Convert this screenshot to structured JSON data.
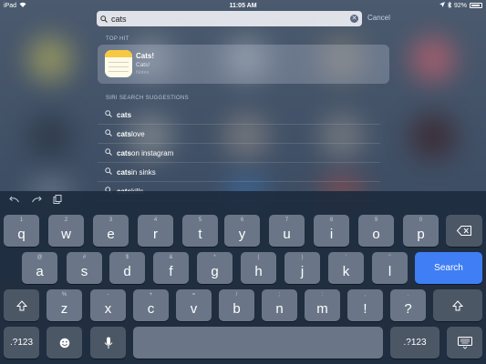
{
  "status_bar": {
    "device": "iPad",
    "time": "11:05 AM",
    "battery": "92%",
    "battery_level": 0.92
  },
  "search": {
    "query": "cats",
    "cancel_label": "Cancel"
  },
  "top_hit": {
    "section_label": "TOP HIT",
    "title": "Cats!",
    "subtitle": "Cats!",
    "app": "Notes"
  },
  "siri_suggestions": {
    "section_label": "SIRI SEARCH SUGGESTIONS",
    "items": [
      {
        "bold": "cats",
        "rest": ""
      },
      {
        "bold": "cats",
        "rest": " love"
      },
      {
        "bold": "cats",
        "rest": " on instagram"
      },
      {
        "bold": "cats",
        "rest": " in sinks"
      },
      {
        "bold": "cats",
        "rest": "kills"
      }
    ]
  },
  "keyboard": {
    "row1": [
      {
        "main": "q",
        "alt": "1"
      },
      {
        "main": "w",
        "alt": "2"
      },
      {
        "main": "e",
        "alt": "3"
      },
      {
        "main": "r",
        "alt": "4"
      },
      {
        "main": "t",
        "alt": "5"
      },
      {
        "main": "y",
        "alt": "6"
      },
      {
        "main": "u",
        "alt": "7"
      },
      {
        "main": "i",
        "alt": "8"
      },
      {
        "main": "o",
        "alt": "9"
      },
      {
        "main": "p",
        "alt": "0"
      }
    ],
    "row2": [
      {
        "main": "a",
        "alt": "@"
      },
      {
        "main": "s",
        "alt": "#"
      },
      {
        "main": "d",
        "alt": "$"
      },
      {
        "main": "f",
        "alt": "&"
      },
      {
        "main": "g",
        "alt": "*"
      },
      {
        "main": "h",
        "alt": "("
      },
      {
        "main": "j",
        "alt": ")"
      },
      {
        "main": "k",
        "alt": "'"
      },
      {
        "main": "l",
        "alt": "\""
      }
    ],
    "row3": [
      {
        "main": "z",
        "alt": "%"
      },
      {
        "main": "x",
        "alt": "-"
      },
      {
        "main": "c",
        "alt": "+"
      },
      {
        "main": "v",
        "alt": "="
      },
      {
        "main": "b",
        "alt": "/"
      },
      {
        "main": "n",
        "alt": ";"
      },
      {
        "main": "m",
        "alt": ":"
      },
      {
        "main": "!",
        "alt": ","
      },
      {
        "main": "?",
        "alt": "."
      }
    ],
    "search_label": "Search",
    "numbers_label": ".?123",
    "accent_color": "#3f7ef4"
  }
}
